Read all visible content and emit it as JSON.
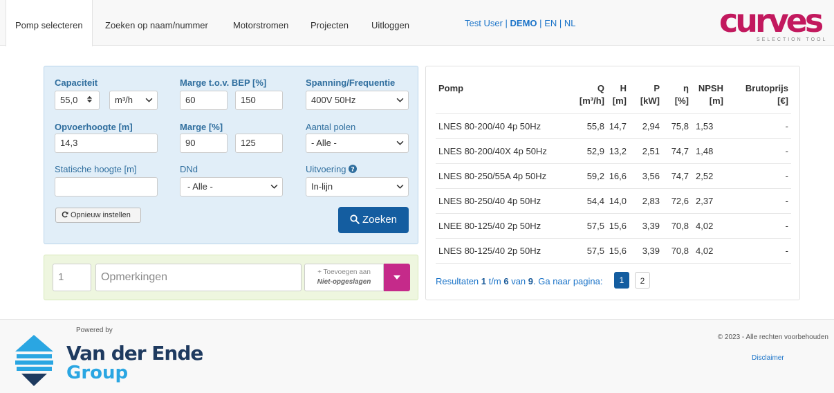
{
  "nav": {
    "items": [
      "Pomp selecteren",
      "Zoeken op naam/nummer",
      "Motorstromen",
      "Projecten",
      "Uitloggen"
    ],
    "user": "Test User",
    "sep": "|",
    "demo": "DEMO",
    "lang_en": "EN",
    "lang_nl": "NL"
  },
  "logo": {
    "brand": "curves",
    "sub": "SELECTION TOOL"
  },
  "form": {
    "capacity_label": "Capaciteit",
    "capacity_value": "55,0",
    "capacity_unit": "m³/h",
    "marge_bep_label": "Marge t.o.v. BEP [%]",
    "marge_bep_min": "60",
    "marge_bep_max": "150",
    "spanning_label": "Spanning/Frequentie",
    "spanning_value": "400V 50Hz",
    "opvoer_label": "Opvoerhoogte [m]",
    "opvoer_value": "14,3",
    "marge_label": "Marge [%]",
    "marge_min": "90",
    "marge_max": "125",
    "polen_label": "Aantal polen",
    "polen_value": "- Alle -",
    "statisch_label": "Statische hoogte [m]",
    "statisch_value": "",
    "dnd_label": "DNd",
    "dnd_value": "- Alle -",
    "uitvoering_label": "Uitvoering",
    "uitvoering_value": "In-lijn",
    "reset_label": "Opnieuw instellen",
    "search_label": "Zoeken"
  },
  "notes": {
    "qty": "1",
    "placeholder": "Opmerkingen",
    "add_line1": "Toevoegen aan",
    "add_line2": "Niet-opgeslagen"
  },
  "results": {
    "headers": [
      {
        "l1": "Pomp",
        "l2": ""
      },
      {
        "l1": "Q",
        "l2": "[m³/h]"
      },
      {
        "l1": "H",
        "l2": "[m]"
      },
      {
        "l1": "P",
        "l2": "[kW]"
      },
      {
        "l1": "η",
        "l2": "[%]"
      },
      {
        "l1": "NPSH",
        "l2": "[m]"
      },
      {
        "l1": "Brutoprijs",
        "l2": "[€]"
      }
    ],
    "rows": [
      [
        "LNES 80-200/40 4p 50Hz",
        "55,8",
        "14,7",
        "2,94",
        "75,8",
        "1,53",
        "-"
      ],
      [
        "LNES 80-200/40X 4p 50Hz",
        "52,9",
        "13,2",
        "2,51",
        "74,7",
        "1,48",
        "-"
      ],
      [
        "LNES 80-250/55A 4p 50Hz",
        "59,2",
        "16,6",
        "3,56",
        "74,7",
        "2,52",
        "-"
      ],
      [
        "LNES 80-250/40 4p 50Hz",
        "54,4",
        "14,0",
        "2,83",
        "72,6",
        "2,37",
        "-"
      ],
      [
        "LNEE 80-125/40 2p 50Hz",
        "57,5",
        "15,6",
        "3,39",
        "70,8",
        "4,02",
        "-"
      ],
      [
        "LNES 80-125/40 2p 50Hz",
        "57,5",
        "15,6",
        "3,39",
        "70,8",
        "4,02",
        "-"
      ]
    ],
    "pager_prefix": "Resultaten",
    "pager_from": "1",
    "pager_tm": "t/m",
    "pager_to": "6",
    "pager_van": "van",
    "pager_total": "9",
    "pager_suffix": ". Ga naar pagina:",
    "pages": [
      "1",
      "2"
    ]
  },
  "footer": {
    "powered": "Powered by",
    "brand_line1": "Van der Ende",
    "brand_line2": "Group",
    "copyright": "© 2023 - Alle rechten voorbehouden",
    "disclaimer": "Disclaimer"
  },
  "colors": {
    "primary": "#145da0",
    "brand": "#c2195e",
    "magenta": "#c52a8a"
  }
}
